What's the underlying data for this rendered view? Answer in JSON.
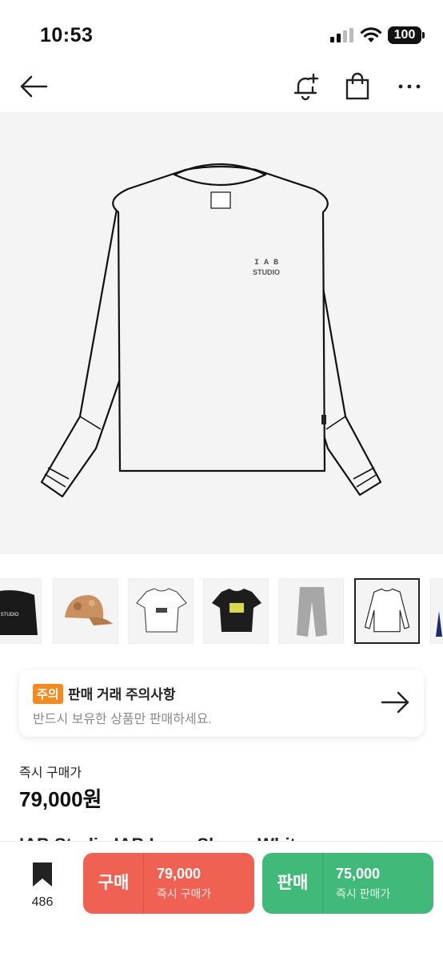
{
  "status_bar": {
    "time": "10:53",
    "battery": "100"
  },
  "nav": {
    "back_icon": "arrow-left-icon",
    "alert_icon": "bell-plus-icon",
    "cart_icon": "shopping-bag-icon",
    "more_icon": "more-horizontal-icon"
  },
  "product_image": {
    "logo_line1": "I A B",
    "logo_line2": "STUDIO"
  },
  "thumbnails": [
    {
      "name": "black-hoodie"
    },
    {
      "name": "camo-cap"
    },
    {
      "name": "white-tshirt"
    },
    {
      "name": "black-tshirt"
    },
    {
      "name": "gray-sweatpants"
    },
    {
      "name": "white-longsleeve",
      "selected": true
    },
    {
      "name": "partial-item"
    }
  ],
  "notice": {
    "badge": "주의",
    "title": "판매 거래 주의사항",
    "subtitle": "반드시 보유한 상품만 판매하세요."
  },
  "price": {
    "label": "즉시 구매가",
    "value": "79,000원"
  },
  "product_title_partial": "IAB Studio IAB Long Sleeve White",
  "bottom_bar": {
    "wish_count": "486",
    "buy": {
      "label": "구매",
      "price": "79,000",
      "sub": "즉시 구매가"
    },
    "sell": {
      "label": "판매",
      "price": "75,000",
      "sub": "즉시 판매가"
    }
  },
  "colors": {
    "buy": "#ef6253",
    "sell": "#41b979",
    "notice_badge": "#f58a1f"
  }
}
